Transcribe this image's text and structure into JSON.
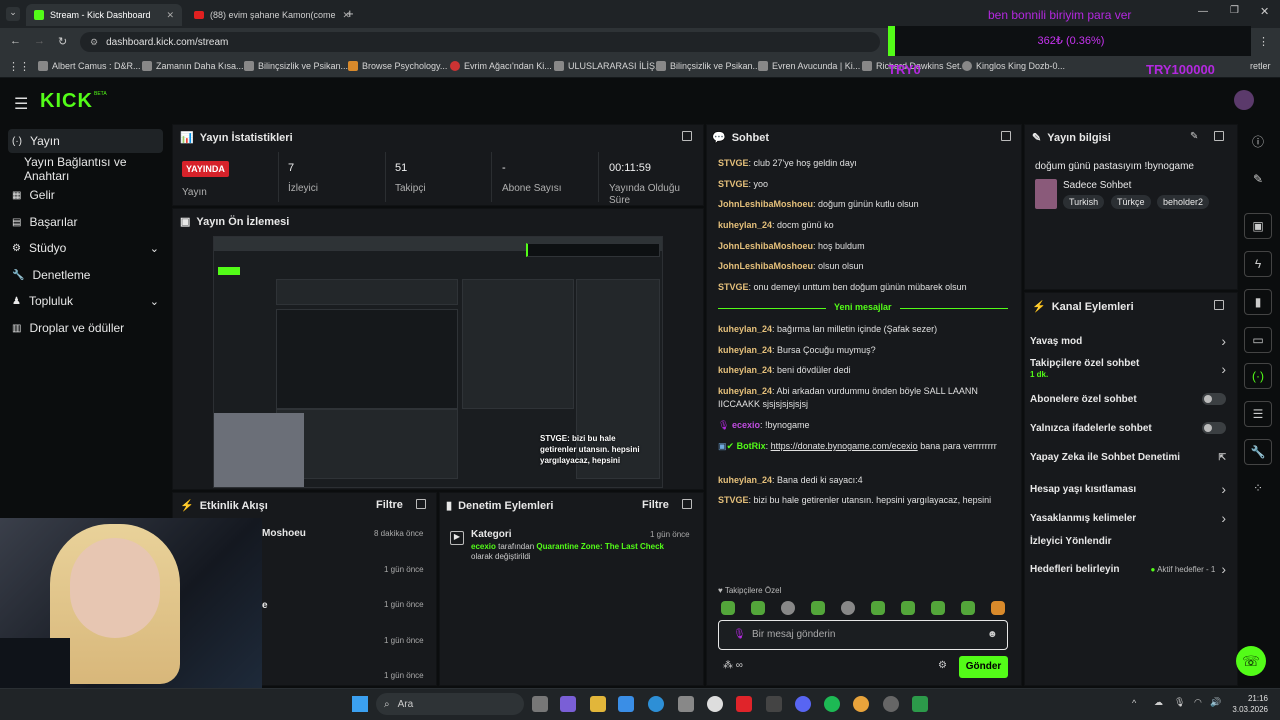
{
  "browser": {
    "tabs": [
      {
        "label": "Stream - Kick Dashboard",
        "active": true
      },
      {
        "label": "(88) evim şahane Kamon(come",
        "active": false
      }
    ],
    "url": "dashboard.kick.com/stream",
    "bookmarks": [
      "Albert Camus : D&R...",
      "Zamanın Daha Kısa...",
      "Bilinçsizlik ve Psikan...",
      "Browse Psychology...",
      "Evrim Ağacı'ndan Ki...",
      "ULUSLARARASI İLİŞ...",
      "Bilinçsizlik ve Psikan...",
      "Evren Avucunda | Ki...",
      "Richard Dawkins Set...",
      "Kinglos King Dozb-0...",
      "retler"
    ]
  },
  "overlay": {
    "goal_title": "ben bonnili biriyim para ver",
    "goal_progress": "362₺ (0.36%)",
    "goal_left": "TRY0",
    "goal_right": "TRY100000",
    "progress_fraction": 0.0036
  },
  "header": {
    "logo": "KICK",
    "logo_sup": "BETA"
  },
  "sidebar": {
    "items": [
      {
        "label": "Yayın",
        "icon": "broadcast-icon",
        "active": true
      },
      {
        "label": "Yayın Bağlantısı ve Anahtarı",
        "icon": "",
        "active": false
      },
      {
        "label": "Gelir",
        "icon": "revenue-icon",
        "active": false
      },
      {
        "label": "Başarılar",
        "icon": "achievements-icon",
        "active": false
      },
      {
        "label": "Stüdyo",
        "icon": "studio-icon",
        "active": false,
        "expandable": true
      },
      {
        "label": "Denetleme",
        "icon": "moderation-icon",
        "active": false
      },
      {
        "label": "Topluluk",
        "icon": "community-icon",
        "active": false,
        "expandable": true
      },
      {
        "label": "Droplar ve ödüller",
        "icon": "drops-icon",
        "active": false
      }
    ]
  },
  "stats": {
    "title": "Yayın İstatistikleri",
    "live_badge": "YAYINDA",
    "live_label": "Yayın",
    "items": [
      {
        "value": "7",
        "label": "İzleyici"
      },
      {
        "value": "51",
        "label": "Takipçi"
      },
      {
        "value": "-",
        "label": "Abone Sayısı"
      },
      {
        "value": "00:11:59",
        "label": "Yayında Olduğu Süre"
      }
    ]
  },
  "preview": {
    "title": "Yayın Ön İzlemesi",
    "overlay_text": "STVGE: bizi bu hale getirenler utansın. hepsini yargılayacaz, hepsini"
  },
  "activity": {
    "title": "Etkinlik Akışı",
    "filter": "Filtre",
    "items": [
      {
        "name": "Moshoeu",
        "time": "8 dakika önce"
      },
      {
        "name": "",
        "time": "1 gün önce"
      },
      {
        "name": "e",
        "time": "1 gün önce"
      },
      {
        "name": "",
        "time": "1 gün önce"
      },
      {
        "name": "",
        "time": "1 gün önce"
      }
    ]
  },
  "modlog": {
    "title": "Denetim Eylemleri",
    "filter": "Filtre",
    "item": {
      "title": "Kategori",
      "time": "1 gün önce",
      "user": "ecexio",
      "text1": " tarafından ",
      "category": "Quarantine Zone: The Last Check",
      "text2": "olarak değiştirildi"
    }
  },
  "chat": {
    "title": "Sohbet",
    "messages": [
      {
        "user": "STVGE",
        "text": "club 27'ye hoş geldin dayı"
      },
      {
        "user": "STVGE",
        "text": "yoo"
      },
      {
        "user": "JohnLeshibaMoshoeu",
        "text": "doğum günün kutlu olsun"
      },
      {
        "user": "kuheylan_24",
        "text": "docm günü ko"
      },
      {
        "user": "JohnLeshibaMoshoeu",
        "text": "hoş buldum"
      },
      {
        "user": "JohnLeshibaMoshoeu",
        "text": "olsun olsun"
      },
      {
        "user": "STVGE",
        "text": "onu demeyi unttum ben doğum günün mübarek olsun"
      }
    ],
    "new_divider": "Yeni mesajlar",
    "messages_new": [
      {
        "user": "kuheylan_24",
        "text": "bağırma lan milletin içinde (Şafak sezer)"
      },
      {
        "user": "kuheylan_24",
        "text": "Bursa Çocuğu muymuş?"
      },
      {
        "user": "kuheylan_24",
        "text": "beni dövdüler dedi"
      },
      {
        "user": "kuheylan_24",
        "text": "Abi arkadan vurdummu önden böyle SALL LAANN IICCAAKK sjsjsjsjsjsjsj"
      },
      {
        "user": "ecexio",
        "text": "!bynogame"
      },
      {
        "user": "BotRix",
        "text": "https://donate.bynogame.com/ecexio",
        "text_after": " bana para verrrrrrrr"
      },
      {
        "user": "kuheylan_24",
        "text": "Bana dedi ki sayacı:4"
      },
      {
        "user": "STVGE",
        "text": "bizi bu hale getirenler utansın. hepsini yargılayacaz, hepsini"
      }
    ],
    "followers_label": "Takipçilere Özel",
    "input_placeholder": "Bir mesaj gönderin",
    "send_label": "Gönder"
  },
  "stream_info": {
    "title": "Yayın bilgisi",
    "stream_title": "doğum günü pastasıyım !bynogame",
    "category": "Sadece Sohbet",
    "tags": [
      "Turkish",
      "Türkçe",
      "beholder2"
    ]
  },
  "channel_actions": {
    "title": "Kanal Eylemleri",
    "items": [
      {
        "label": "Yavaş mod",
        "control": "chevron"
      },
      {
        "label": "Takipçilere özel sohbet",
        "sub": "1 dk.",
        "control": "chevron"
      },
      {
        "label": "Abonelere özel sohbet",
        "control": "toggle"
      },
      {
        "label": "Yalnızca ifadelerle sohbet",
        "control": "toggle"
      },
      {
        "label": "Yapay Zeka ile Sohbet Denetimi",
        "control": "external"
      },
      {
        "label": "Hesap yaşı kısıtlaması",
        "control": "chevron"
      },
      {
        "label": "Yasaklanmış kelimeler",
        "control": "chevron"
      },
      {
        "label": "İzleyici Yönlendir",
        "control": "none"
      },
      {
        "label": "Hedefleri belirleyin",
        "control": "chevron",
        "status": "Aktif hedefler - 1"
      }
    ]
  },
  "taskbar": {
    "search": "Ara",
    "time": "21:16",
    "date": "3.03.2026"
  },
  "colors": {
    "accent": "#53fc18",
    "live": "#d6222a",
    "username": "#e5c07b"
  }
}
